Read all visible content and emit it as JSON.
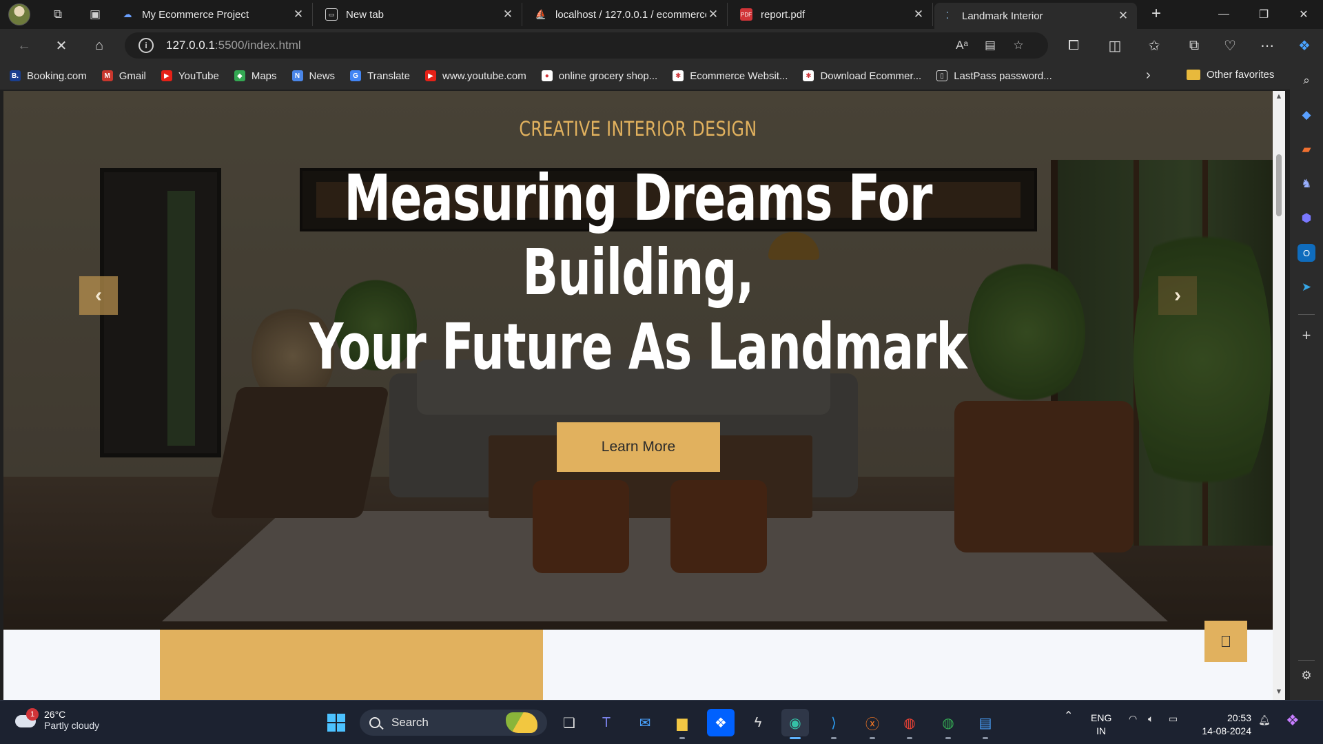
{
  "browser": {
    "tabs": [
      {
        "label": "My Ecommerce Project",
        "icon": "cloud-tab-icon"
      },
      {
        "label": "New tab",
        "icon": "newtab-page-icon"
      },
      {
        "label": "localhost / 127.0.0.1 / ecommerce",
        "icon": "phpmyadmin-icon"
      },
      {
        "label": "report.pdf",
        "icon": "pdf-icon"
      },
      {
        "label": "Landmark Interior",
        "icon": "loading-icon"
      }
    ],
    "new_tab_symbol": "+",
    "url_host": "127.0.0.1",
    "url_path": ":5500/index.html",
    "favorites": [
      {
        "label": "Booking.com",
        "badge": "B."
      },
      {
        "label": "Gmail",
        "badge": "M"
      },
      {
        "label": "YouTube",
        "badge": "▶"
      },
      {
        "label": "Maps",
        "badge": "◆"
      },
      {
        "label": "News",
        "badge": "N"
      },
      {
        "label": "Translate",
        "badge": "G"
      },
      {
        "label": "www.youtube.com",
        "badge": "▶"
      },
      {
        "label": "online grocery shop...",
        "badge": "●"
      },
      {
        "label": "Ecommerce Websit...",
        "badge": "✱"
      },
      {
        "label": "Download Ecommer...",
        "badge": "✱"
      },
      {
        "label": "LastPass password...",
        "badge": "▯"
      }
    ],
    "other_favorites": "Other favorites"
  },
  "page": {
    "eyebrow": "CREATIVE INTERIOR DESIGN",
    "headline_line1": "Measuring Dreams For",
    "headline_line2": "Building,",
    "headline_line3": "Your Future As Landmark",
    "cta_label": "Learn More",
    "prev_symbol": "‹",
    "next_symbol": "›",
    "accent_color": "#e1b15e"
  },
  "taskbar": {
    "weather_temp": "26°C",
    "weather_desc": "Partly cloudy",
    "weather_badge": "1",
    "search_label": "Search",
    "lang_line1": "ENG",
    "lang_line2": "IN",
    "time": "20:53",
    "date": "14-08-2024"
  }
}
